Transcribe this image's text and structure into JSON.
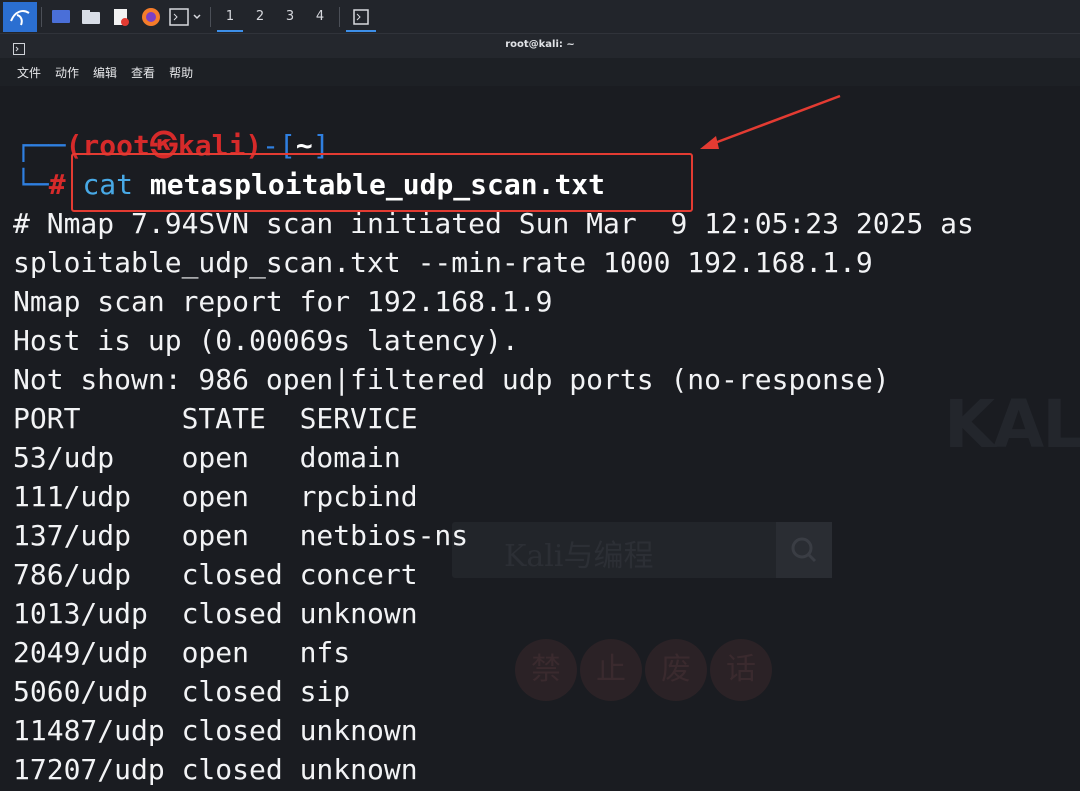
{
  "panel": {
    "workspaces": [
      "1",
      "2",
      "3",
      "4"
    ],
    "active_workspace": "1",
    "icons": [
      "kali-menu-icon",
      "desktop-icon",
      "file-manager-icon",
      "text-editor-icon",
      "firefox-icon",
      "terminal-icon",
      "terminal-task-icon"
    ]
  },
  "window": {
    "title": "root@kali: ~"
  },
  "menu": {
    "items": [
      "文件",
      "动作",
      "编辑",
      "查看",
      "帮助"
    ]
  },
  "terminal": {
    "prompt_user": "(root㉿kali)",
    "prompt_dir": "~",
    "prompt_hash": "#",
    "command": "cat",
    "argument": "metasploitable_udp_scan.txt",
    "output": [
      "# Nmap 7.94SVN scan initiated Sun Mar  9 12:05:23 2025 as",
      "sploitable_udp_scan.txt --min-rate 1000 192.168.1.9",
      "Nmap scan report for 192.168.1.9",
      "Host is up (0.00069s latency).",
      "Not shown: 986 open|filtered udp ports (no-response)",
      "PORT      STATE  SERVICE",
      "53/udp    open   domain",
      "111/udp   open   rpcbind",
      "137/udp   open   netbios-ns",
      "786/udp   closed concert",
      "1013/udp  closed unknown",
      "2049/udp  open   nfs",
      "5060/udp  closed sip",
      "11487/udp closed unknown",
      "17207/udp closed unknown"
    ]
  },
  "watermark": {
    "brand": "KALI",
    "search_text": "Kali与编程",
    "seal_chars": [
      "禁",
      "止",
      "废",
      "话"
    ]
  },
  "colors": {
    "accent_blue": "#2f7fe0",
    "prompt_red": "#d62a2a",
    "highlight_red": "#e33b32"
  }
}
